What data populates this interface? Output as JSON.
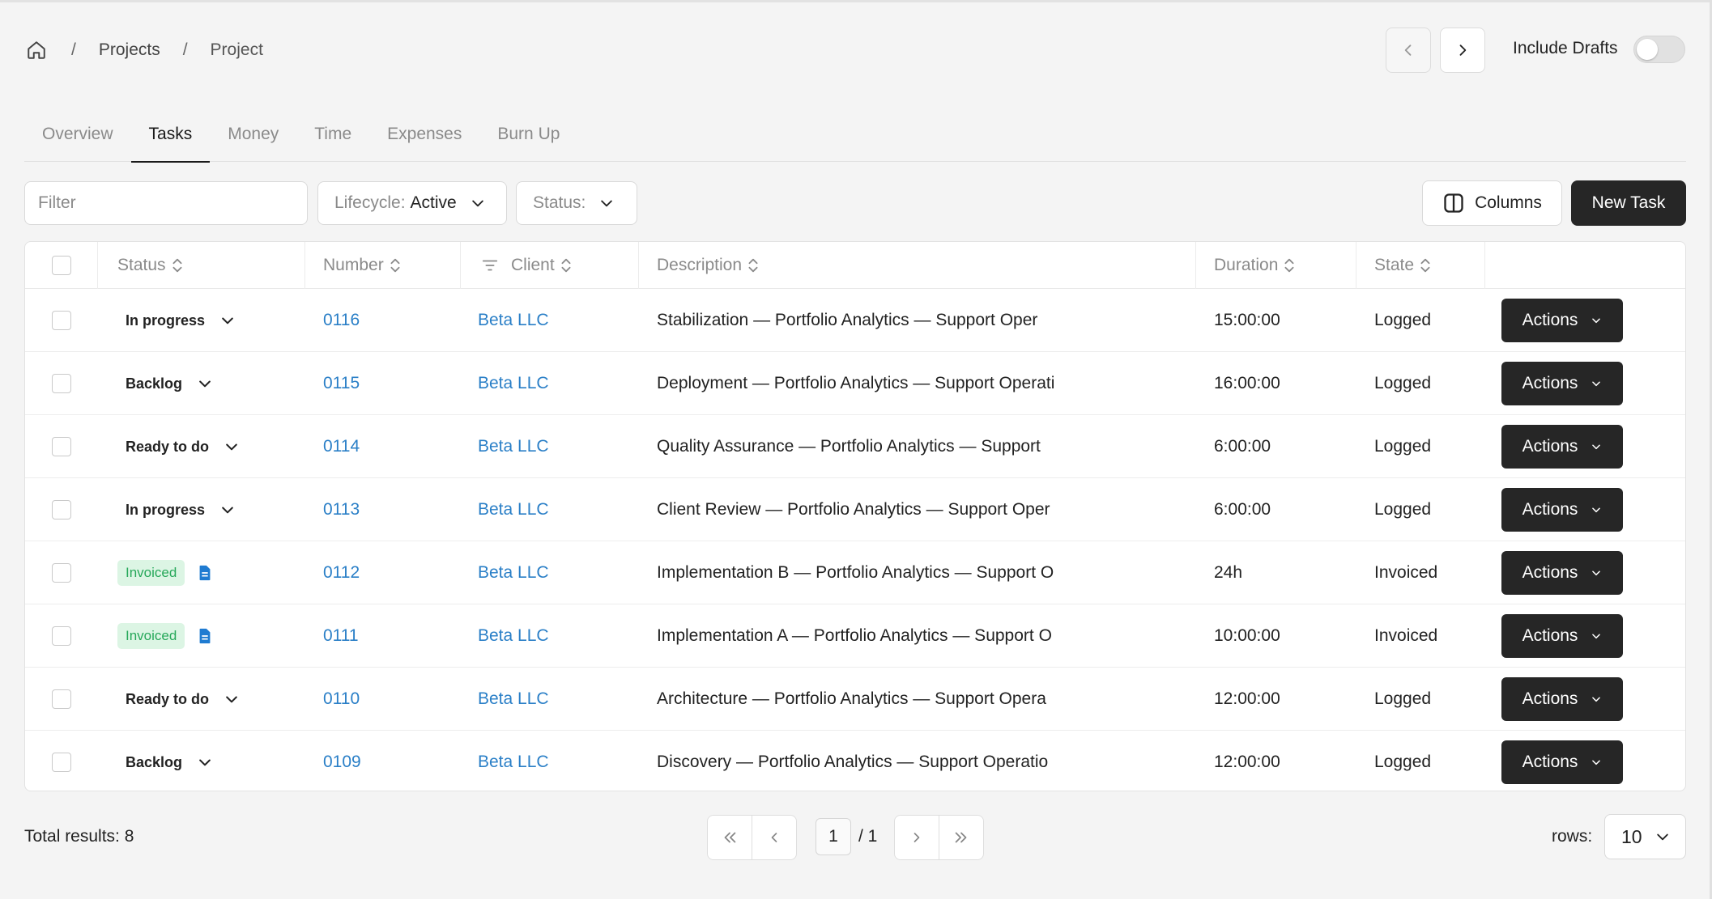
{
  "breadcrumb": {
    "projects": "Projects",
    "project": "Project"
  },
  "header": {
    "include_drafts": "Include Drafts"
  },
  "tabs": [
    "Overview",
    "Tasks",
    "Money",
    "Time",
    "Expenses",
    "Burn Up"
  ],
  "active_tab": "Tasks",
  "toolbar": {
    "filter_placeholder": "Filter",
    "lifecycle_label": "Lifecycle:",
    "lifecycle_value": "Active",
    "status_label": "Status:",
    "columns_label": "Columns",
    "new_task_label": "New Task"
  },
  "table": {
    "headers": {
      "status": "Status",
      "number": "Number",
      "client": "Client",
      "description": "Description",
      "duration": "Duration",
      "state": "State"
    },
    "rows": [
      {
        "status": "In progress",
        "status_type": "dropdown",
        "number": "0116",
        "client": "Beta LLC",
        "description": "Stabilization — Portfolio Analytics — Support Oper",
        "duration": "15:00:00",
        "state": "Logged",
        "action": "Actions"
      },
      {
        "status": "Backlog",
        "status_type": "dropdown",
        "number": "0115",
        "client": "Beta LLC",
        "description": "Deployment — Portfolio Analytics — Support Operati",
        "duration": "16:00:00",
        "state": "Logged",
        "action": "Actions"
      },
      {
        "status": "Ready to do",
        "status_type": "dropdown",
        "number": "0114",
        "client": "Beta LLC",
        "description": "Quality Assurance — Portfolio Analytics — Support",
        "duration": "6:00:00",
        "state": "Logged",
        "action": "Actions"
      },
      {
        "status": "In progress",
        "status_type": "dropdown",
        "number": "0113",
        "client": "Beta LLC",
        "description": "Client Review — Portfolio Analytics — Support Oper",
        "duration": "6:00:00",
        "state": "Logged",
        "action": "Actions"
      },
      {
        "status": "Invoiced",
        "status_type": "badge",
        "number": "0112",
        "client": "Beta LLC",
        "description": "Implementation B — Portfolio Analytics — Support O",
        "duration": "24h",
        "state": "Invoiced",
        "action": "Actions"
      },
      {
        "status": "Invoiced",
        "status_type": "badge",
        "number": "0111",
        "client": "Beta LLC",
        "description": "Implementation A — Portfolio Analytics — Support O",
        "duration": "10:00:00",
        "state": "Invoiced",
        "action": "Actions"
      },
      {
        "status": "Ready to do",
        "status_type": "dropdown",
        "number": "0110",
        "client": "Beta LLC",
        "description": "Architecture — Portfolio Analytics — Support Opera",
        "duration": "12:00:00",
        "state": "Logged",
        "action": "Actions"
      },
      {
        "status": "Backlog",
        "status_type": "dropdown",
        "number": "0109",
        "client": "Beta LLC",
        "description": "Discovery — Portfolio Analytics — Support Operatio",
        "duration": "12:00:00",
        "state": "Logged",
        "action": "Actions"
      }
    ]
  },
  "footer": {
    "total": "Total results: 8",
    "page": "1",
    "page_total": "/ 1",
    "rows_label": "rows:",
    "rows_value": "10"
  },
  "colors": {
    "accent_dark": "#262626",
    "link": "#2a7fc7",
    "invoiced_bg": "#dcf5e4",
    "invoiced_text": "#27a85a",
    "doc_icon": "#1f7bd1"
  },
  "icons": [
    "home-icon",
    "chevron-left-icon",
    "chevron-right-icon",
    "chevron-down-icon",
    "sort-icon",
    "filter-lines-icon",
    "columns-icon",
    "document-icon",
    "double-chevron-left-icon",
    "double-chevron-right-icon"
  ]
}
